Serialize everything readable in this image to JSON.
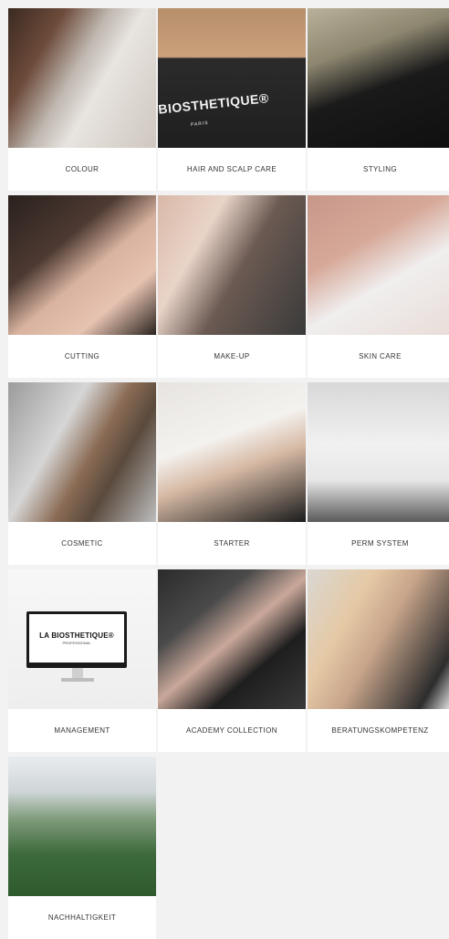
{
  "tiles": [
    {
      "label": "COLOUR",
      "photo": "colour"
    },
    {
      "label": "HAIR AND SCALP CARE",
      "photo": "hair"
    },
    {
      "label": "STYLING",
      "photo": "styling"
    },
    {
      "label": "CUTTING",
      "photo": "cutting"
    },
    {
      "label": "MAKE-UP",
      "photo": "makeup"
    },
    {
      "label": "SKIN CARE",
      "photo": "skin"
    },
    {
      "label": "COSMETIC",
      "photo": "cosmetic"
    },
    {
      "label": "STARTER",
      "photo": "starter"
    },
    {
      "label": "PERM SYSTEM",
      "photo": "perm"
    },
    {
      "label": "MANAGEMENT",
      "photo": "mgmt"
    },
    {
      "label": "ACADEMY COLLECTION",
      "photo": "academy"
    },
    {
      "label": "BERATUNGSKOMPETENZ",
      "photo": "beratung"
    },
    {
      "label": "NACHHALTIGKEIT",
      "photo": "nach"
    }
  ],
  "hair_bag": {
    "brand": "BIOSTHETIQUE®",
    "sub": "PARIS"
  },
  "monitor": {
    "brand": "LA BIOSTHETIQUE®",
    "sub": "PROFESSIONAL"
  }
}
